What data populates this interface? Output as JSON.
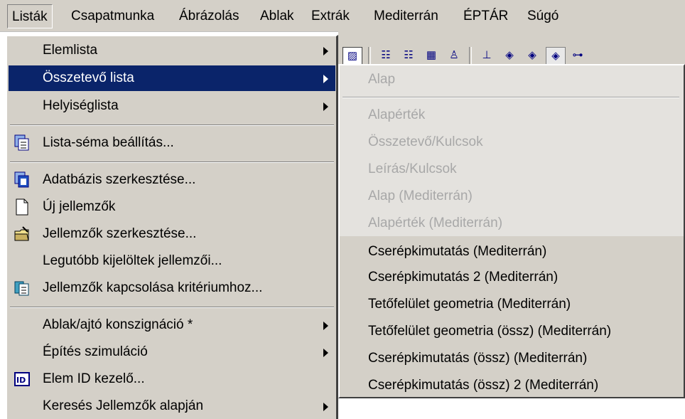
{
  "menubar": {
    "items": [
      {
        "label": "Listák",
        "active": true
      },
      {
        "label": "Csapatmunka"
      },
      {
        "label": "Ábrázolás"
      },
      {
        "label": "Ablak"
      },
      {
        "label": "Extrák"
      },
      {
        "label": "Mediterrán"
      },
      {
        "label": "ÉPTÁR"
      },
      {
        "label": "Súgó"
      }
    ]
  },
  "toolbar": {
    "icons": [
      "wall-tool-icon",
      "list-icon",
      "list2-icon",
      "grid-icon",
      "person-icon",
      "axis-icon",
      "shape1-icon",
      "shape2-icon",
      "shape3-icon",
      "shape4-icon"
    ]
  },
  "main_menu": {
    "items": [
      {
        "label": "Elemlista",
        "submenu": true
      },
      {
        "label": "Összetevő lista",
        "submenu": true,
        "highlighted": true
      },
      {
        "label": "Helyiséglista",
        "submenu": true
      },
      {
        "label": "Lista-séma beállítás...",
        "icon": "list-schema-icon"
      },
      {
        "label": "Adatbázis szerkesztése...",
        "icon": "database-icon"
      },
      {
        "label": "Új jellemzők",
        "icon": "new-document-icon"
      },
      {
        "label": "Jellemzők szerkesztése...",
        "icon": "edit-folder-icon"
      },
      {
        "label": "Legutóbb kijelöltek jellemzői..."
      },
      {
        "label": "Jellemzők kapcsolása kritériumhoz...",
        "icon": "link-criteria-icon"
      },
      {
        "label": "Ablak/ajtó konszignáció *",
        "submenu": true
      },
      {
        "label": "Építés szimuláció",
        "submenu": true
      },
      {
        "label": "Elem ID kezelő...",
        "icon": "id-icon"
      },
      {
        "label": "Keresés Jellemzők alapján",
        "submenu": true
      }
    ]
  },
  "sub_menu": {
    "items": [
      {
        "label": "Alap",
        "disabled": true
      },
      {
        "label": "Alapérték",
        "disabled": true
      },
      {
        "label": "Összetevő/Kulcsok",
        "disabled": true
      },
      {
        "label": "Leírás/Kulcsok",
        "disabled": true
      },
      {
        "label": "Alap (Mediterrán)",
        "disabled": true
      },
      {
        "label": "Alapérték (Mediterrán)",
        "disabled": true
      },
      {
        "label": "Cserépkimutatás (Mediterrán)"
      },
      {
        "label": "Cserépkimutatás 2 (Mediterrán)"
      },
      {
        "label": "Tetőfelület geometria (Mediterrán)"
      },
      {
        "label": "Tetőfelület geometria (össz) (Mediterrán)"
      },
      {
        "label": "Cserépkimutatás (össz) (Mediterrán)"
      },
      {
        "label": "Cserépkimutatás (össz) 2 (Mediterrán)"
      }
    ]
  },
  "colors": {
    "menu_bg": "#d4d0c8",
    "highlight": "#0a246a",
    "disabled_text": "#a8a8a8"
  }
}
